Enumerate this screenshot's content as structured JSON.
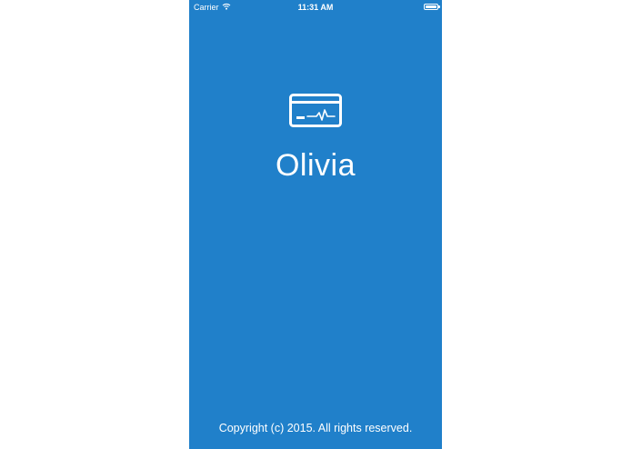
{
  "status_bar": {
    "carrier": "Carrier",
    "time": "11:31 AM",
    "wifi_icon": "wifi-icon",
    "battery_icon": "battery-icon"
  },
  "app": {
    "logo_icon": "credit-card-pulse-icon",
    "name": "Olivia",
    "copyright": "Copyright (c) 2015. All rights reserved."
  },
  "colors": {
    "background": "#2080ca",
    "foreground": "#ffffff"
  }
}
